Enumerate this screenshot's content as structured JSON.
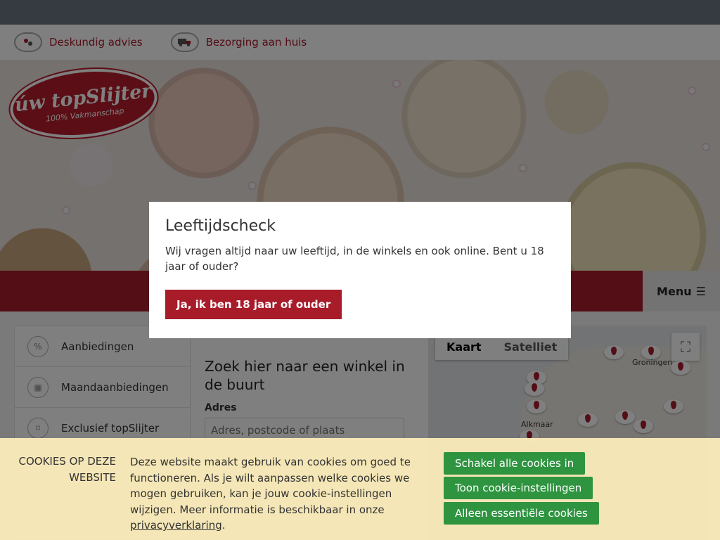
{
  "usp": [
    {
      "label": "Deskundig advies",
      "icon": "advice-chat-icon"
    },
    {
      "label": "Bezorging aan huis",
      "icon": "delivery-truck-icon"
    }
  ],
  "logo": {
    "main": "úw topSlijter",
    "sub": "100% Vakmanschap"
  },
  "menu": {
    "label": "Menu",
    "icon": "hamburger-icon"
  },
  "sidenav": {
    "items": [
      {
        "label": "Aanbiedingen",
        "icon": "percent-icon"
      },
      {
        "label": "Maandaanbiedingen",
        "icon": "calendar-icon"
      },
      {
        "label": "Exclusief topSlijter",
        "icon": "bookmark-icon"
      }
    ]
  },
  "finder": {
    "title": "Zoek hier naar een winkel in de buurt",
    "address_label": "Adres",
    "address_placeholder": "Adres, postcode of plaats"
  },
  "map": {
    "tab_map": "Kaart",
    "tab_satellite": "Satelliet",
    "cities": [
      "Groningen",
      "Alkmaar"
    ]
  },
  "modal": {
    "title": "Leeftijdscheck",
    "text": "Wij vragen altijd naar uw leeftijd, in de winkels en ook online. Bent u 18 jaar of ouder?",
    "button": "Ja, ik ben 18 jaar of ouder"
  },
  "cookies": {
    "heading": "COOKIES OP DEZE WEBSITE",
    "text_before": "Deze website maakt gebruik van cookies om goed te functioneren. Als je wilt aanpassen welke cookies we mogen gebruiken, kan je jouw cookie-instellingen wijzigen. Meer informatie is beschikbaar in onze ",
    "link": "privacyverklaring",
    "text_after": ".",
    "btn_all": "Schakel alle cookies in",
    "btn_settings": "Toon cookie-instellingen",
    "btn_essential": "Alleen essentiële cookies"
  },
  "colors": {
    "brand_red": "#a81c2a",
    "cookie_green": "#2f9440",
    "cookie_bg": "#fdeeba"
  }
}
